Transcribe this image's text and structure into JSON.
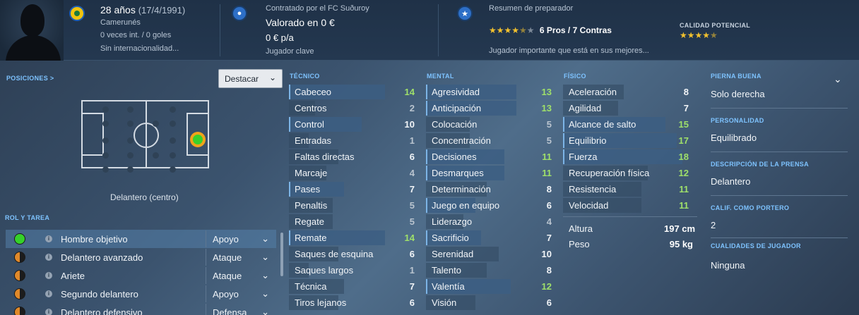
{
  "header": {
    "age": "28 años",
    "dob": "(17/4/1991)",
    "nationality": "Camerunés",
    "intl": "0 veces int. / 0 goles",
    "intl_status": "Sin internacionalidad...",
    "contract": "Contratado por el FC Suðuroy",
    "value": "Valorado en 0 €",
    "wage": "0 € p/a",
    "squad_status": "Jugador clave",
    "coach_title": "Resumen de preparador",
    "pros_cons": "6 Pros / 7 Contras",
    "coach_stars": "★★★★",
    "coach_half": "★",
    "coach_empty": "★",
    "coach_summary": "Jugador importante que está en sus mejores...",
    "potential_label": "CALIDAD POTENCIAL",
    "potential_stars": "★★★★",
    "potential_half": "★"
  },
  "left": {
    "positions_label": "POSICIONES >",
    "highlight_select": "Destacar",
    "position_name": "Delantero (centro)",
    "role_label": "ROL Y TAREA",
    "roles": [
      {
        "name": "Hombre objetivo",
        "duty": "Apoyo"
      },
      {
        "name": "Delantero avanzado",
        "duty": "Ataque"
      },
      {
        "name": "Ariete",
        "duty": "Ataque"
      },
      {
        "name": "Segundo delantero",
        "duty": "Apoyo"
      },
      {
        "name": "Delantero defensivo",
        "duty": "Defensa"
      }
    ]
  },
  "technical": {
    "label": "TÉCNICO",
    "rows": [
      {
        "name": "Cabeceo",
        "value": "14"
      },
      {
        "name": "Centros",
        "value": "2"
      },
      {
        "name": "Control",
        "value": "10"
      },
      {
        "name": "Entradas",
        "value": "1"
      },
      {
        "name": "Faltas directas",
        "value": "6"
      },
      {
        "name": "Marcaje",
        "value": "4"
      },
      {
        "name": "Pases",
        "value": "7"
      },
      {
        "name": "Penaltis",
        "value": "5"
      },
      {
        "name": "Regate",
        "value": "5"
      },
      {
        "name": "Remate",
        "value": "14"
      },
      {
        "name": "Saques de esquina",
        "value": "6"
      },
      {
        "name": "Saques largos",
        "value": "1"
      },
      {
        "name": "Técnica",
        "value": "7"
      },
      {
        "name": "Tiros lejanos",
        "value": "6"
      }
    ]
  },
  "mental": {
    "label": "MENTAL",
    "rows": [
      {
        "name": "Agresividad",
        "value": "13"
      },
      {
        "name": "Anticipación",
        "value": "13"
      },
      {
        "name": "Colocación",
        "value": "5"
      },
      {
        "name": "Concentración",
        "value": "5"
      },
      {
        "name": "Decisiones",
        "value": "11"
      },
      {
        "name": "Desmarques",
        "value": "11"
      },
      {
        "name": "Determinación",
        "value": "8"
      },
      {
        "name": "Juego en equipo",
        "value": "6"
      },
      {
        "name": "Liderazgo",
        "value": "4"
      },
      {
        "name": "Sacrificio",
        "value": "7"
      },
      {
        "name": "Serenidad",
        "value": "10"
      },
      {
        "name": "Talento",
        "value": "8"
      },
      {
        "name": "Valentía",
        "value": "12"
      },
      {
        "name": "Visión",
        "value": "6"
      }
    ]
  },
  "physical": {
    "label": "FÍSICO",
    "rows": [
      {
        "name": "Aceleración",
        "value": "8"
      },
      {
        "name": "Agilidad",
        "value": "7"
      },
      {
        "name": "Alcance de salto",
        "value": "15"
      },
      {
        "name": "Equilibrio",
        "value": "17"
      },
      {
        "name": "Fuerza",
        "value": "18"
      },
      {
        "name": "Recuperación física",
        "value": "12"
      },
      {
        "name": "Resistencia",
        "value": "11"
      },
      {
        "name": "Velocidad",
        "value": "11"
      }
    ],
    "height_label": "Altura",
    "height_value": "197 cm",
    "weight_label": "Peso",
    "weight_value": "95 kg"
  },
  "right": {
    "foot_label": "PIERNA BUENA",
    "foot_value": "Solo derecha",
    "personality_label": "PERSONALIDAD",
    "personality_value": "Equilibrado",
    "press_label": "DESCRIPCIÓN DE LA PRENSA",
    "press_value": "Delantero",
    "gk_label": "CALIF. COMO PORTERO",
    "gk_value": "2",
    "qualities_label": "CUALIDADES DE JUGADOR",
    "qualities_value": "Ninguna"
  },
  "colors": {
    "accent": "#7ec3ff",
    "star": "#f2c12e",
    "good_value": "#9fe06a",
    "selected_position": "#39d12a"
  }
}
